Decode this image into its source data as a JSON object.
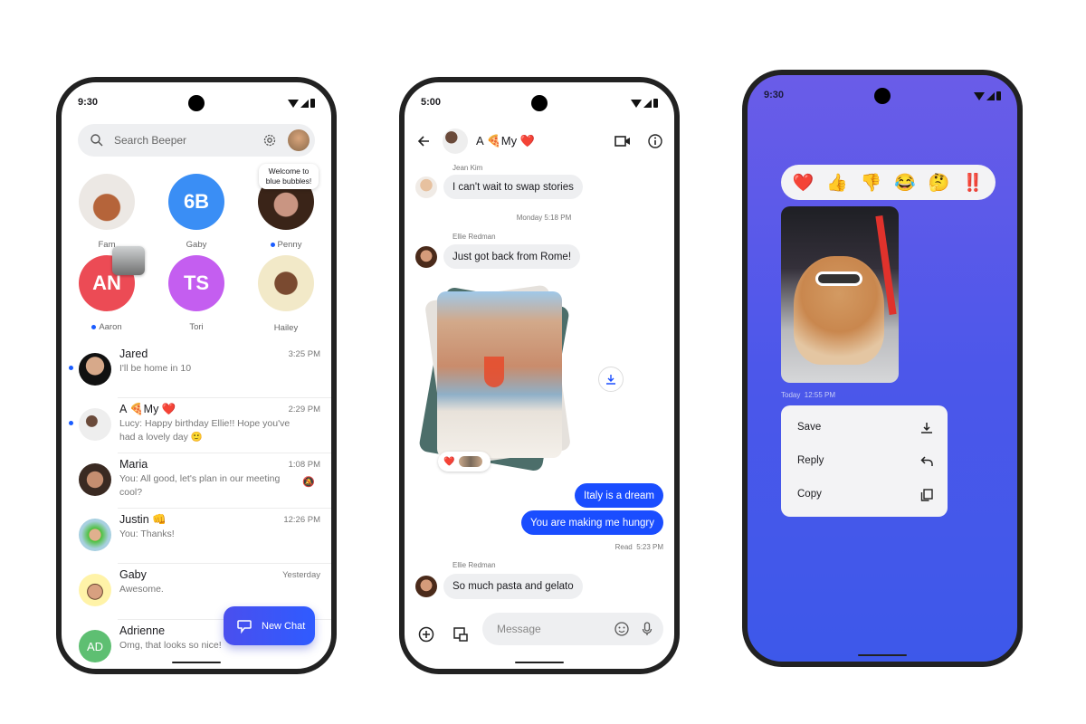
{
  "colors": {
    "accent": "#1a4dff",
    "unread_dot": "#1a5cff",
    "phone3_bg_top": "#6a5ce8",
    "phone3_bg_bottom": "#3d58ea"
  },
  "phone1": {
    "status_time": "9:30",
    "search": {
      "placeholder": "Search Beeper",
      "icon": "search-icon",
      "settings_icon": "gear-icon"
    },
    "tooltip": "Welcome to blue bubbles!",
    "stories": [
      {
        "label": "Fam",
        "dot": false
      },
      {
        "label": "Gaby",
        "initials": "6B",
        "color": "#3a8ef5",
        "dot": false
      },
      {
        "label": "Penny",
        "dot": true
      },
      {
        "label": "Aaron",
        "initials": "AN",
        "color": "#ec4b55",
        "dot": true
      },
      {
        "label": "Tori",
        "initials": "TS",
        "color": "#c45ef0",
        "dot": false
      },
      {
        "label": "Hailey",
        "dot": false
      }
    ],
    "chats": [
      {
        "name": "Jared",
        "time": "3:25 PM",
        "preview": "I'll be home in 10",
        "unread": true
      },
      {
        "name": "A 🍕My ❤️",
        "time": "2:29 PM",
        "preview": "Lucy: Happy birthday Ellie!! Hope you've had a lovely day 🙂",
        "unread": true
      },
      {
        "name": "Maria",
        "time": "1:08 PM",
        "preview": "You: All good, let's plan in our meeting cool?",
        "unread": false,
        "muted": true
      },
      {
        "name": "Justin 👊",
        "time": "12:26 PM",
        "preview": "You: Thanks!",
        "unread": false
      },
      {
        "name": "Gaby",
        "time": "Yesterday",
        "preview": "Awesome.",
        "unread": false
      },
      {
        "name": "Adrienne",
        "time": "",
        "preview": "Omg, that looks so nice!",
        "initials": "AD",
        "unread": false
      }
    ],
    "fab_label": "New Chat"
  },
  "phone2": {
    "status_time": "5:00",
    "title": "A 🍕My ❤️",
    "messages": {
      "m1_sender": "Jean Kim",
      "m1_text": "I can't wait to swap stories",
      "divider": "Monday 5:18 PM",
      "m2_sender": "Ellie Redman",
      "m2_text": "Just got back from Rome!",
      "reaction": "❤️",
      "m3_text": "Italy is a dream",
      "m4_text": "You are making me hungry",
      "read_receipt": "Read  5:23 PM",
      "m5_sender": "Ellie Redman",
      "m5_text": "So much pasta and gelato"
    },
    "composer_placeholder": "Message"
  },
  "phone3": {
    "status_time": "9:30",
    "reactions": [
      "❤️",
      "👍",
      "👎",
      "😂",
      "🤔",
      "‼️"
    ],
    "photo_time": "Today  12:55 PM",
    "menu": [
      {
        "label": "Save",
        "icon": "download-icon"
      },
      {
        "label": "Reply",
        "icon": "reply-icon"
      },
      {
        "label": "Copy",
        "icon": "copy-icon"
      }
    ]
  }
}
